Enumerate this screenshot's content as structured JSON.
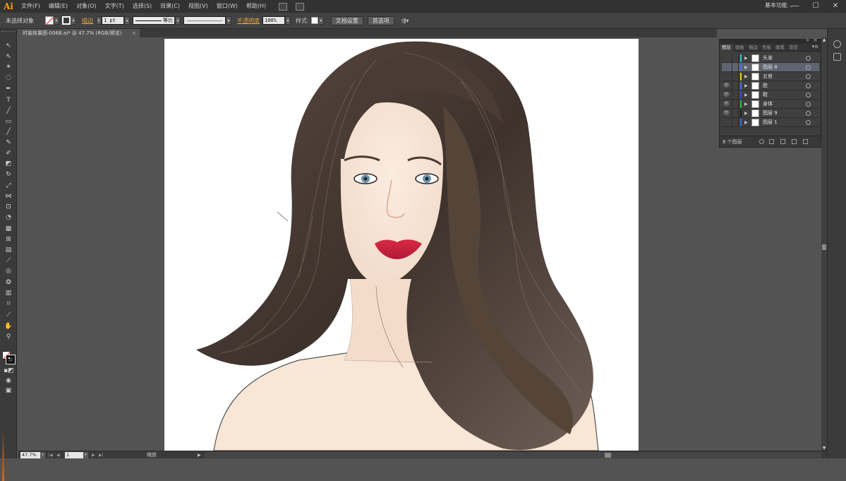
{
  "app": {
    "logo": "Ai",
    "workspace": "基本功能 ⌄"
  },
  "menu": [
    "文件(F)",
    "编辑(E)",
    "对象(O)",
    "文字(T)",
    "选择(S)",
    "效果(C)",
    "视图(V)",
    "窗口(W)",
    "帮助(H)"
  ],
  "window_controls": {
    "minimize": "—",
    "maximize": "☐",
    "close": "✕"
  },
  "control": {
    "selection_label": "未选择对象",
    "stroke_label": "描边",
    "stroke_weight": "1 pt",
    "profile_label": "等比",
    "opacity_label": "不透明度",
    "opacity_value": "100%",
    "style_label": "样式:",
    "doc_setup": "文档设置",
    "preferences": "首选项"
  },
  "document_tab": {
    "title": "时装效果图-006B.ai* @ 47.7% (RGB/预览)",
    "close": "×"
  },
  "layers_panel": {
    "collapse": "»",
    "close": "×",
    "tabs": [
      "图层",
      "画板",
      "描边",
      "色板",
      "画笔",
      "渐变"
    ],
    "menu": "▾≡",
    "layers": [
      {
        "name": "头发",
        "color": "#1fc8c8",
        "visible": false,
        "selected": false
      },
      {
        "name": "图层 8",
        "color": "#4a6ef0",
        "visible": false,
        "selected": true
      },
      {
        "name": "五官",
        "color": "#e8d020",
        "visible": false,
        "selected": false
      },
      {
        "name": "脸",
        "color": "#4a6ef0",
        "visible": true,
        "selected": false
      },
      {
        "name": "鞋",
        "color": "#3050e0",
        "visible": true,
        "selected": false
      },
      {
        "name": "身体",
        "color": "#20c040",
        "visible": true,
        "selected": false
      },
      {
        "name": "图层 9",
        "color": "#202020",
        "visible": true,
        "selected": false
      },
      {
        "name": "图层 1",
        "color": "#3070e0",
        "visible": false,
        "selected": false
      }
    ],
    "count_label": "8 个图层"
  },
  "status": {
    "zoom": "47.7%",
    "page": "1",
    "status_text": "缩放"
  },
  "icons": {
    "eye": "👁",
    "expand": "▶",
    "dropdown": "▾"
  }
}
